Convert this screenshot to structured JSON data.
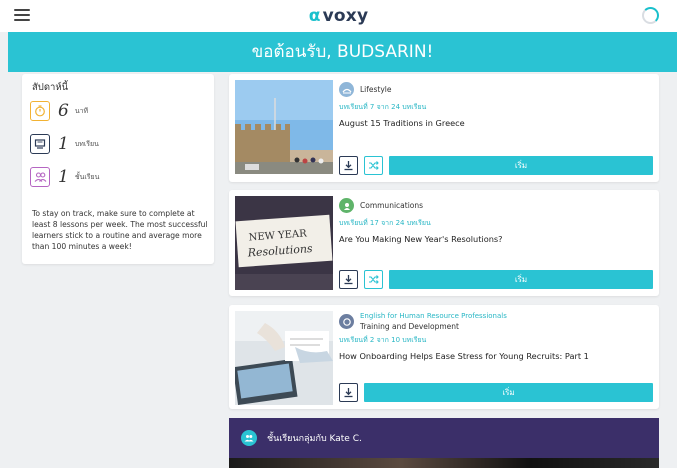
{
  "topbar": {
    "brand": "voxy",
    "brand_mark": "α"
  },
  "banner": {
    "greeting": "ขอต้อนรับ, BUDSARIN!"
  },
  "weekly": {
    "title": "สัปดาห์นี้",
    "stats": [
      {
        "icon": "timer-icon",
        "value": "6",
        "label": "นาที",
        "color": "#f2b233"
      },
      {
        "icon": "lesson-icon",
        "value": "1",
        "label": "บทเรียน",
        "color": "#2b3a55"
      },
      {
        "icon": "people-icon",
        "value": "1",
        "label": "ชั้นเรียน",
        "color": "#b565c2"
      }
    ],
    "tip": "To stay on track, make sure to complete at least 8 lessons per week. The most successful learners stick to a routine and average more than 100 minutes a week!"
  },
  "lessons": [
    {
      "category": "Lifestyle",
      "subcategory": "",
      "progress": "บทเรียนที่ 7 จาก 24 บทเรียน",
      "title": "August 15 Traditions in Greece",
      "start_label": "เริ่ม",
      "has_shuffle": true,
      "category_icon": "lifestyle-icon",
      "category_color": "#8fb6d8"
    },
    {
      "category": "Communications",
      "subcategory": "",
      "progress": "บทเรียนที่ 17 จาก 24 บทเรียน",
      "title": "Are You Making New Year's Resolutions?",
      "start_label": "เริ่ม",
      "has_shuffle": true,
      "category_icon": "communications-icon",
      "category_color": "#5fb46a"
    },
    {
      "category": "English for Human Resource Professionals",
      "subcategory": "Training and Development",
      "progress": "บทเรียนที่ 2 จาก 10 บทเรียน",
      "title": "How Onboarding Helps Ease Stress for Young Recruits: Part 1",
      "start_label": "เริ่ม",
      "has_shuffle": false,
      "category_icon": "hr-course-icon",
      "category_color": "#6c7ea0"
    }
  ],
  "group_class": {
    "title": "ชั้นเรียนกลุ่มกับ Kate C."
  },
  "colors": {
    "accent": "#2ac3d3",
    "dark_purple": "#3b2f69"
  }
}
